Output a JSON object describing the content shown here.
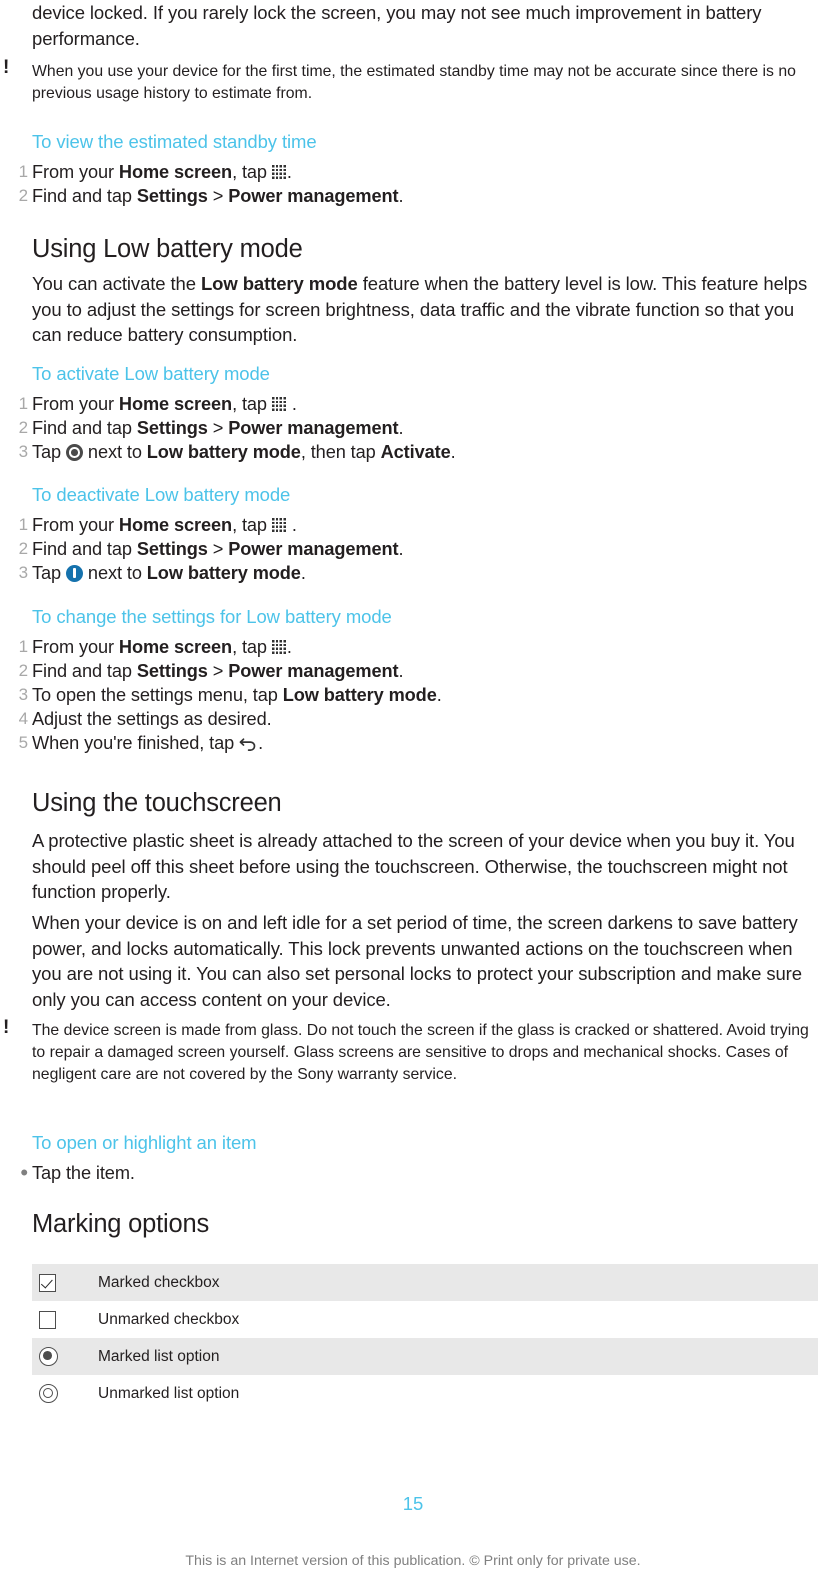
{
  "document": {
    "page_number": "15",
    "footer_note": "This is an Internet version of this publication. © Print only for private use.",
    "accent_color": "#4cc3e9",
    "text_color": "#231f20"
  },
  "top_paragraph": {
    "text_a": "device locked. If you rarely lock the screen, you may not see much improvement in",
    "text_b": "battery performance."
  },
  "note_standby": {
    "marker": "!",
    "marker_icon": "exclamation-icon",
    "text": "When you use your device for the first time, the estimated standby time may not be accurate since there is no previous usage history to estimate from."
  },
  "proc_view_standby": {
    "title": "To view the estimated standby time",
    "steps": [
      {
        "num": "1",
        "pre": "From your ",
        "bold1": "Home screen",
        "mid": ", tap ",
        "icon": "app-drawer-icon",
        "post": "."
      },
      {
        "num": "2",
        "pre": "Find and tap ",
        "bold1": "Settings",
        "mid": " > ",
        "bold2": "Power management",
        "post": "."
      }
    ]
  },
  "section_low_battery": {
    "title": "Using Low battery mode",
    "paragraph_pre": "You can activate the ",
    "paragraph_bold": "Low battery mode",
    "paragraph_post": " feature when the battery level is low. This feature helps you to adjust the settings for screen brightness, data traffic and the vibrate function so that you can reduce battery consumption."
  },
  "proc_activate": {
    "title": "To activate Low battery mode",
    "steps": [
      {
        "num": "1",
        "pre": "From your ",
        "bold1": "Home screen",
        "mid": ", tap ",
        "icon": "app-drawer-icon",
        "post": " ."
      },
      {
        "num": "2",
        "pre": "Find and tap ",
        "bold1": "Settings",
        "mid": " > ",
        "bold2": "Power management",
        "post": "."
      },
      {
        "num": "3",
        "pre": "Tap ",
        "icon": "toggle-off-icon",
        "mid": " next to ",
        "bold1": "Low battery mode",
        "mid2": ", then tap ",
        "bold2": "Activate",
        "post": "."
      }
    ]
  },
  "proc_deactivate": {
    "title": "To deactivate Low battery mode",
    "steps": [
      {
        "num": "1",
        "pre": "From your ",
        "bold1": "Home screen",
        "mid": ", tap ",
        "icon": "app-drawer-icon",
        "post": " ."
      },
      {
        "num": "2",
        "pre": "Find and tap ",
        "bold1": "Settings",
        "mid": " > ",
        "bold2": "Power management",
        "post": "."
      },
      {
        "num": "3",
        "pre": "Tap ",
        "icon": "power-on-icon",
        "mid": " next to ",
        "bold1": "Low battery mode",
        "post": "."
      }
    ]
  },
  "proc_change_settings": {
    "title": "To change the settings for Low battery mode",
    "steps": [
      {
        "num": "1",
        "pre": "From your ",
        "bold1": "Home screen",
        "mid": ", tap ",
        "icon": "app-drawer-icon",
        "post": "."
      },
      {
        "num": "2",
        "pre": "Find and tap ",
        "bold1": "Settings",
        "mid": " > ",
        "bold2": "Power management",
        "post": "."
      },
      {
        "num": "3",
        "pre": "To open the settings menu, tap ",
        "bold1": "Low battery mode",
        "post": "."
      },
      {
        "num": "4",
        "pre": "Adjust the settings as desired.",
        "post": ""
      },
      {
        "num": "5",
        "pre": "When you're finished, tap ",
        "icon": "back-arrow-icon",
        "post": "."
      }
    ]
  },
  "section_touchscreen": {
    "title": "Using the touchscreen",
    "paragraph_1": "A protective plastic sheet is already attached to the screen of your device when you buy it. You should peel off this sheet before using the touchscreen. Otherwise, the touchscreen might not function properly.",
    "paragraph_2": "When your device is on and left idle for a set period of time, the screen darkens to save battery power, and locks automatically. This lock prevents unwanted actions on the touchscreen when you are not using it. You can also set personal locks to protect your subscription and make sure only you can access content on your device."
  },
  "note_glass": {
    "marker": "!",
    "marker_icon": "exclamation-icon",
    "text": "The device screen is made from glass. Do not touch the screen if the glass is cracked or shattered. Avoid trying to repair a damaged screen yourself. Glass screens are sensitive to drops and mechanical shocks. Cases of negligent care are not covered by the Sony warranty service."
  },
  "proc_open_item": {
    "title": "To open or highlight an item",
    "bullet": "•",
    "step_text": "Tap the item."
  },
  "section_marking": {
    "title": "Marking options",
    "rows": [
      {
        "icon": "checkbox-checked-icon",
        "label": "Marked checkbox",
        "shaded": true
      },
      {
        "icon": "checkbox-unchecked-icon",
        "label": "Unmarked checkbox",
        "shaded": false
      },
      {
        "icon": "radio-marked-icon",
        "label": "Marked list option",
        "shaded": true
      },
      {
        "icon": "radio-unmarked-icon",
        "label": "Unmarked list option",
        "shaded": false
      }
    ]
  }
}
